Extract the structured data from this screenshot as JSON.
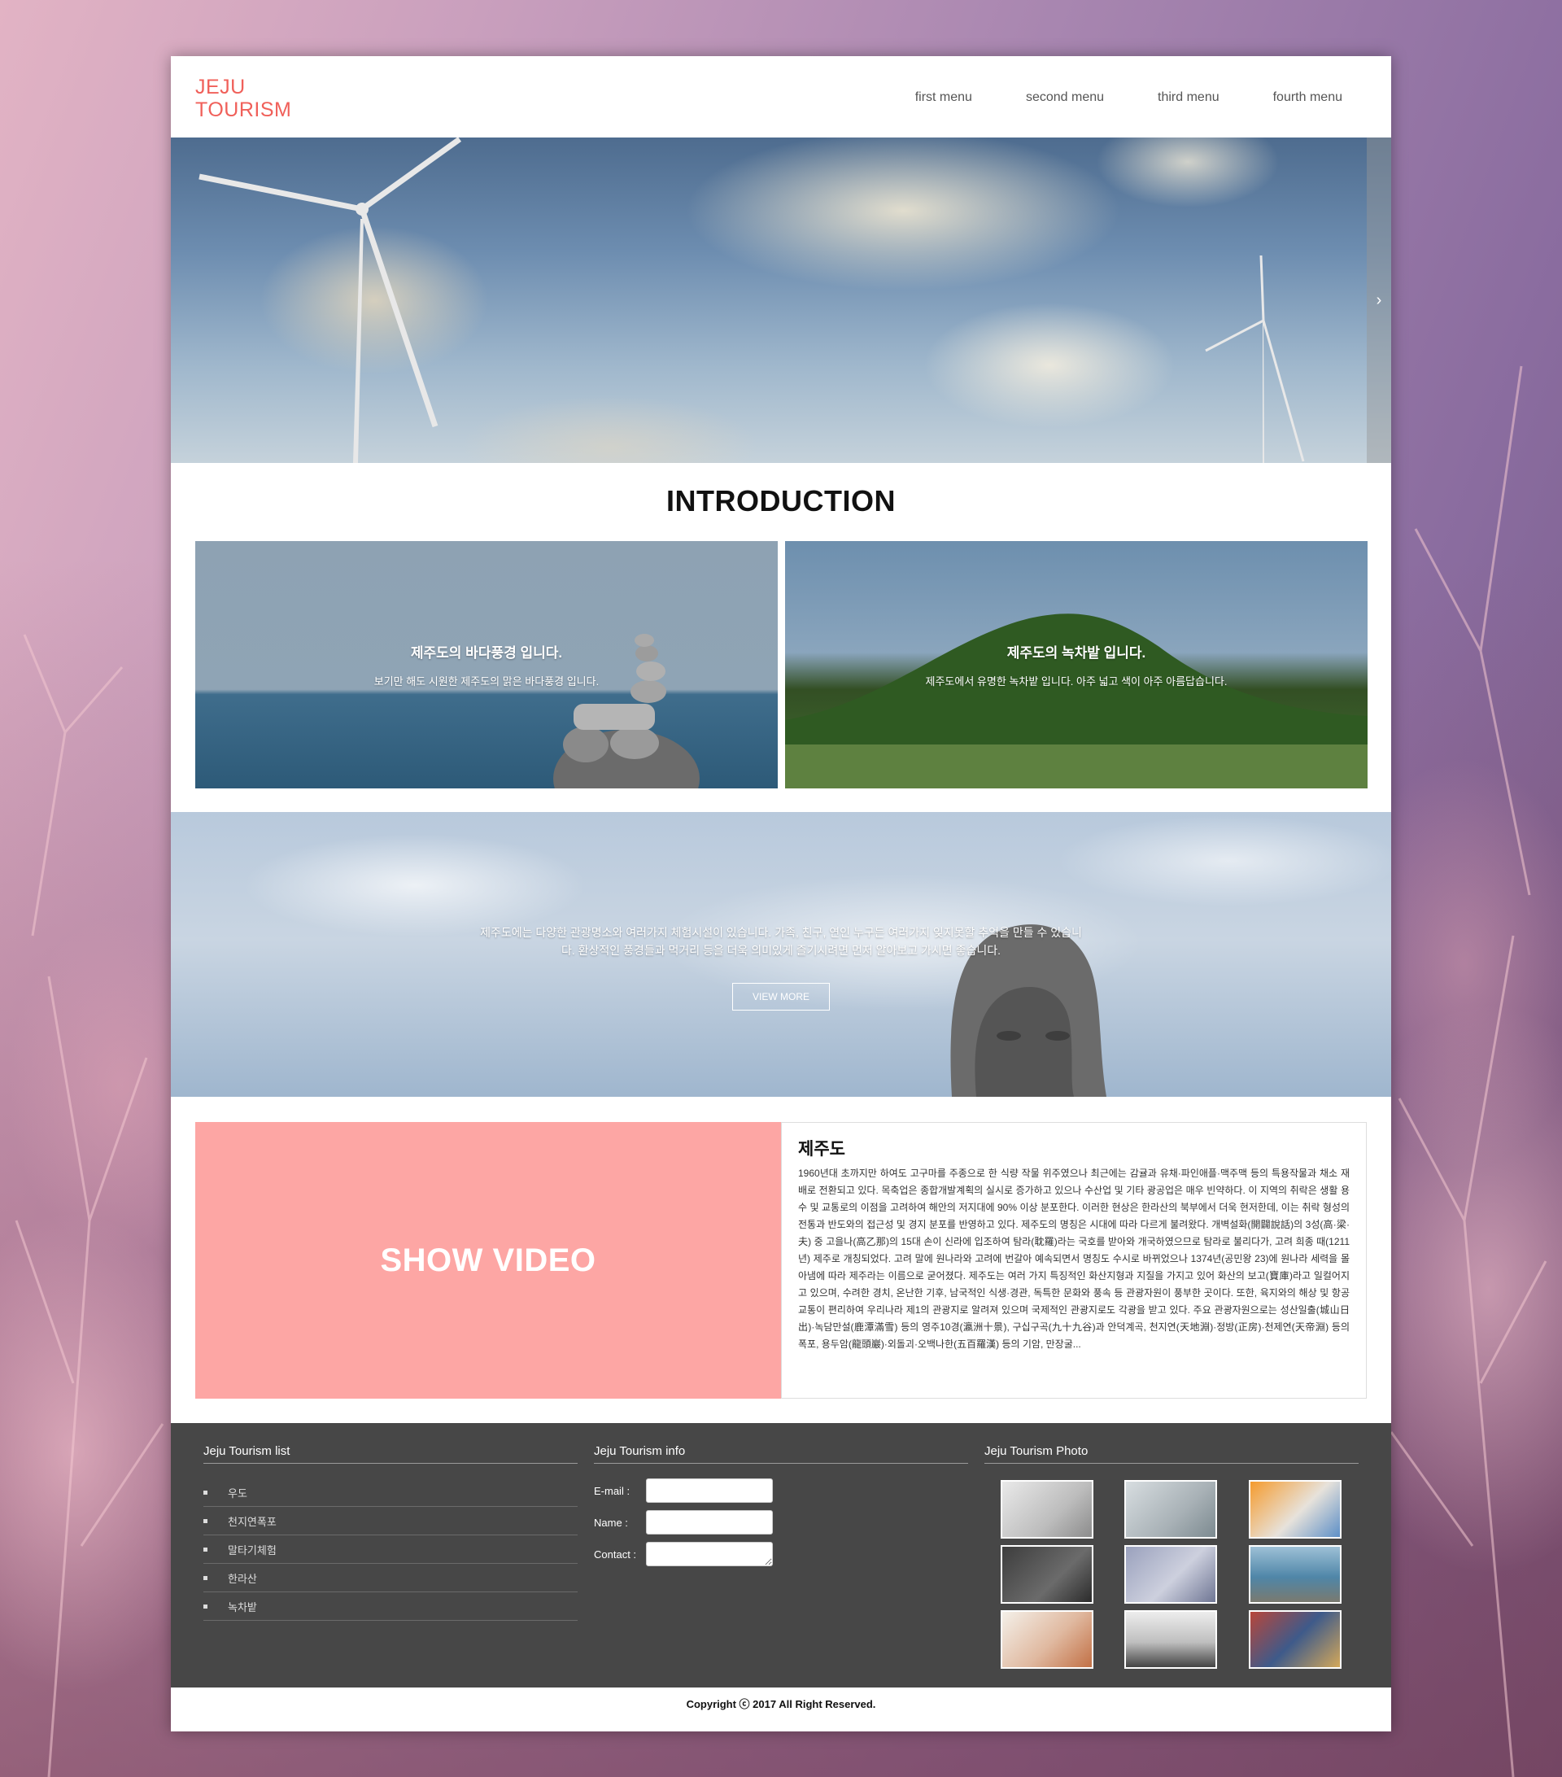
{
  "header": {
    "logo_line1": "JEJU",
    "logo_line2": "TOURISM",
    "nav": [
      "first menu",
      "second menu",
      "third menu",
      "fourth menu"
    ]
  },
  "hero": {
    "next_icon": "chevron-right-icon",
    "next_glyph": "›"
  },
  "intro": {
    "title": "INTRODUCTION",
    "cards": [
      {
        "title": "제주도의 바다풍경 입니다.",
        "text": "보기만 해도 시원한 제주도의 맑은 바다풍경 입니다."
      },
      {
        "title": "제주도의 녹차밭 입니다.",
        "text": "제주도에서 유명한 녹차밭 입니다. 아주 넓고 색이 아주 아름답습니다."
      }
    ]
  },
  "banner": {
    "text": "제주도에는 다양한 관광명소와 여러가지 체험시설이 있습니다. 가족, 친구, 연인 누구든 여러가지 잊지못할 추억을 만들 수 있습니다. 환상적인 풍경들과 먹거리 등을 더욱 의미있게 즐기시려면 먼저 알아보고 가시면 좋습니다.",
    "button": "VIEW MORE"
  },
  "video": {
    "label": "SHOW VIDEO"
  },
  "info": {
    "title": "제주도",
    "body": "1960년대 초까지만 하여도 고구마를 주종으로 한 식량 작물 위주였으나 최근에는 감귤과 유채·파인애플·맥주맥 등의 특용작물과 채소 재배로 전환되고 있다. 목축업은 종합개발계획의 실시로 증가하고 있으나 수산업 및 기타 광공업은 매우 빈약하다. 이 지역의 취락은 생활 용수 및 교통로의 이점을 고려하여 해안의 저지대에 90% 이상 분포한다. 이러한 현상은 한라산의 북부에서 더욱 현저한데, 이는 취락 형성의 전통과 반도와의 접근성 및 경지 분포를 반영하고 있다. 제주도의 명칭은 시대에 따라 다르게 불려왔다. 개벽설화(開闢說話)의 3성(高·梁·夫) 중 고을나(高乙那)의 15대 손이 신라에 입조하여 탐라(耽羅)라는 국호를 받아와 개국하였으므로 탐라로 불리다가, 고려 희종 때(1211년) 제주로 개칭되었다. 고려 말에 원나라와 고려에 번갈아 예속되면서 명칭도 수시로 바뀌었으나 1374년(공민왕 23)에 원나라 세력을 몰아냄에 따라 제주라는 이름으로 굳어졌다. 제주도는 여러 가지 특징적인 화산지형과 지질을 가지고 있어 화산의 보고(寶庫)라고 일컬어지고 있으며, 수려한 경치, 온난한 기후, 남국적인 식생·경관, 독특한 문화와 풍속 등 관광자원이 풍부한 곳이다. 또한, 육지와의 해상 및 항공교통이 편리하여 우리나라 제1의 관광지로 알려져 있으며 국제적인 관광지로도 각광을 받고 있다. 주요 관광자원으로는 성산일출(城山日出)·녹담만설(鹿潭滿雪) 등의 영주10경(瀛洲十景), 구십구곡(九十九谷)과 안덕계곡, 천지연(天地淵)·정방(正房)·천제연(天帝淵) 등의 폭포, 용두암(龍頭巖)·외돌괴·오백나한(五百羅漢) 등의 기암, 만장굴..."
  },
  "footer": {
    "list_title": "Jeju Tourism list",
    "list_items": [
      "우도",
      "천지연폭포",
      "말타기체험",
      "한라산",
      "녹차밭"
    ],
    "info_title": "Jeju Tourism info",
    "form": {
      "email_label": "E-mail :",
      "name_label": "Name :",
      "contact_label": "Contact :"
    },
    "photo_title": "Jeju Tourism Photo"
  },
  "copyright": "Copyright ⓒ 2017 All Right Reserved."
}
